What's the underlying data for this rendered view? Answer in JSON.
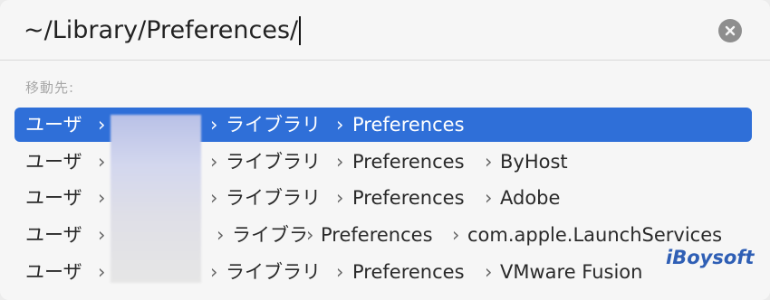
{
  "search": {
    "path_value": "~/Library/Preferences/"
  },
  "section_label": "移動先:",
  "rows": [
    {
      "user": "ユーザ",
      "library": "ライブラリ",
      "prefs": "Preferences",
      "sub": "",
      "selected": true
    },
    {
      "user": "ユーザ",
      "library": "ライブラリ",
      "prefs": "Preferences",
      "sub": "ByHost",
      "selected": false
    },
    {
      "user": "ユーザ",
      "library": "ライブラリ",
      "prefs": "Preferences",
      "sub": "Adobe",
      "selected": false
    },
    {
      "user": "ユーザ",
      "library": "ライブラ",
      "prefs": "Preferences",
      "sub": "com.apple.LaunchServices",
      "selected": false
    },
    {
      "user": "ユーザ",
      "library": "ライブラリ",
      "prefs": "Preferences",
      "sub": "VMware Fusion",
      "selected": false
    }
  ],
  "chevron": "›",
  "icons": {
    "clear": "clear-icon"
  },
  "colors": {
    "selection": "#2f6fd8",
    "watermark": "#2f5fb5"
  },
  "watermark": "iBoysoft"
}
